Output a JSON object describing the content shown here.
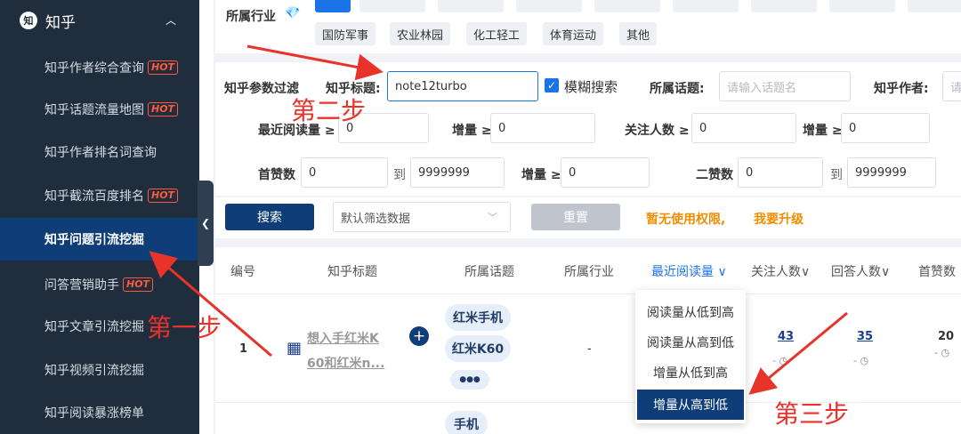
{
  "sidebar": {
    "title": "知乎",
    "logo_text": "知",
    "hot_label": "HOT",
    "items": [
      {
        "label": "知乎作者综合查询",
        "hot": true
      },
      {
        "label": "知乎话题流量地图",
        "hot": true
      },
      {
        "label": "知乎作者排名词查询",
        "hot": false
      },
      {
        "label": "知乎截流百度排名",
        "hot": true
      },
      {
        "label": "知乎问题引流挖掘",
        "hot": false,
        "active": true
      },
      {
        "label": "问答营销助手",
        "hot": true
      },
      {
        "label": "知乎文章引流挖掘",
        "hot": false
      },
      {
        "label": "知乎视频引流挖掘",
        "hot": false
      },
      {
        "label": "知乎阅读暴涨榜单",
        "hot": false
      }
    ]
  },
  "industry": {
    "label": "所属行业",
    "row2_tags": [
      "国防军事",
      "农业林园",
      "化工轻工",
      "体育运动",
      "其他"
    ]
  },
  "filter": {
    "label": "知乎参数过滤",
    "title_label": "知乎标题:",
    "title_value": "note12turbo",
    "fuzzy_label": "模糊搜索",
    "topic_label": "所属话题:",
    "topic_placeholder": "请输入话题名",
    "author_label": "知乎作者:",
    "author_placeholder": "请",
    "read_label": "最近阅读量 ≥",
    "read_value": "0",
    "inc_label": "增量 ≥",
    "inc_value": "0",
    "follow_label": "关注人数 ≥",
    "follow_value": "0",
    "inc2_label": "增量 ≥",
    "inc2_value": "0",
    "first_like_label": "首赞数",
    "first_like_from": "0",
    "to_label": "到",
    "first_like_to": "9999999",
    "inc3_label": "增量 ≥",
    "inc3_value": "0",
    "second_like_label": "二赞数",
    "second_like_from": "0",
    "to_label2": "到",
    "second_like_to": "9999999"
  },
  "actions": {
    "search": "搜索",
    "preset": "默认筛选数据",
    "reset": "重置",
    "no_permission": "暂无使用权限,",
    "upgrade": "我要升级"
  },
  "table": {
    "headers": [
      "编号",
      "知乎标题",
      "所属话题",
      "所属行业",
      "最近阅读量",
      "关注人数",
      "回答人数",
      "首赞数"
    ],
    "row": {
      "index": "1",
      "title_line1": "想入手红米K",
      "title_line2": "60和红米n...",
      "topics": [
        "红米手机",
        "红米K60"
      ],
      "more": "●●●",
      "industry": "-",
      "follow": "43",
      "answers": "35",
      "first_like": "20",
      "dash": "-"
    },
    "next_row_topic": "手机"
  },
  "sort_menu": [
    "阅读量从低到高",
    "阅读量从高到低",
    "增量从低到高",
    "增量从高到低"
  ],
  "annotations": {
    "step1": "第一步",
    "step2": "第二步",
    "step3": "第三步"
  },
  "colors": {
    "sidebar_bg": "#1f2d3d",
    "active_item": "#0f3d78",
    "primary": "#1a73e8",
    "hot": "#ff5a3c",
    "annotation": "#e8332b",
    "warning_text": "#f08c00"
  }
}
